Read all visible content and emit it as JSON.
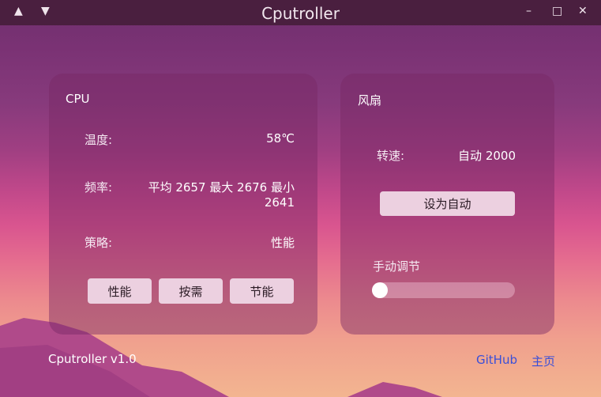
{
  "window": {
    "title": "Cputroller",
    "controls": {
      "collapse_icon": "▲",
      "expand_icon": "▼",
      "minimize": "–",
      "maximize": "□",
      "close": "✕"
    }
  },
  "cpu": {
    "title": "CPU",
    "temperature": {
      "label": "温度:",
      "value": "58℃"
    },
    "frequency": {
      "label": "频率:",
      "value": "平均 2657 最大 2676 最小 2641"
    },
    "policy": {
      "label": "策略:",
      "value": "性能"
    },
    "buttons": {
      "performance": "性能",
      "on_demand": "按需",
      "power_save": "节能"
    }
  },
  "fan": {
    "title": "风扇",
    "speed": {
      "label": "转速:",
      "value": "自动 2000"
    },
    "auto_button": "设为自动",
    "manual_label": "手动调节",
    "slider_level": 0
  },
  "footer": {
    "version": "Cputroller v1.0",
    "github_link": "GitHub",
    "home_link": "主页"
  }
}
